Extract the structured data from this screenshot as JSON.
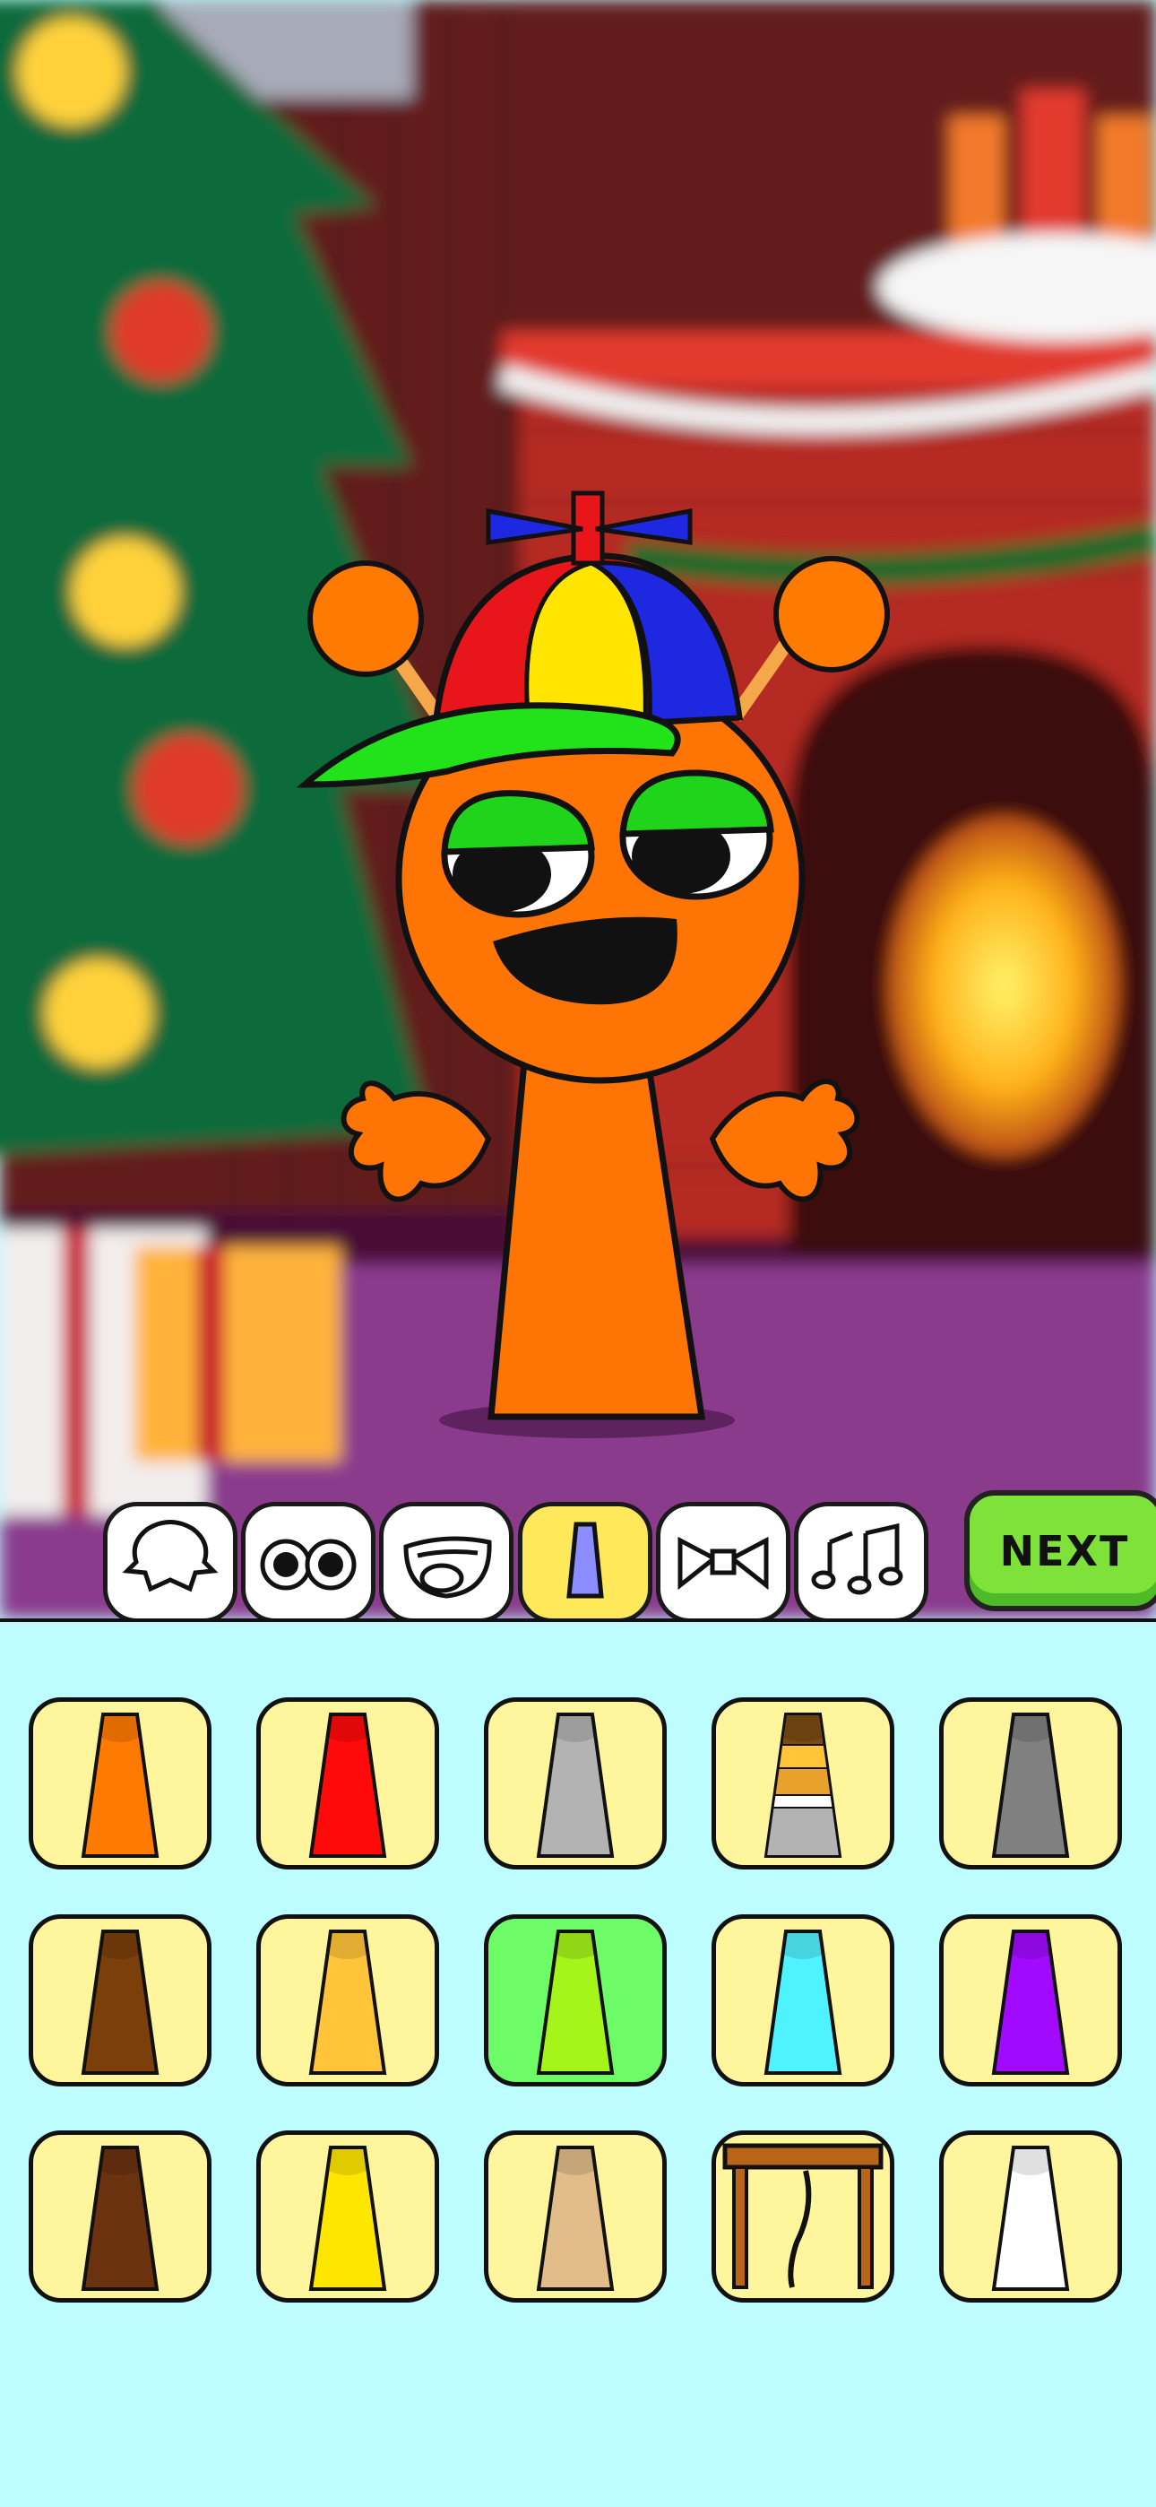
{
  "toolbar": {
    "tabs": [
      {
        "name": "head-shape",
        "icon": "head-shape-icon"
      },
      {
        "name": "eyes",
        "icon": "eyes-icon"
      },
      {
        "name": "mouth",
        "icon": "mouth-icon"
      },
      {
        "name": "body",
        "icon": "body-icon",
        "active": true
      },
      {
        "name": "accessory",
        "icon": "bow-tie-icon"
      },
      {
        "name": "sound",
        "icon": "music-notes-icon"
      }
    ],
    "next_label": "NEXT"
  },
  "body_options": [
    {
      "color": "#ff7a00"
    },
    {
      "color": "#ff0a0a"
    },
    {
      "color": "#b3b3b3"
    },
    {
      "color": "#e8b23a",
      "style": "striped"
    },
    {
      "color": "#808080"
    },
    {
      "color": "#7a3f0b"
    },
    {
      "color": "#ffc43a"
    },
    {
      "color": "#a6f51a",
      "selected": true
    },
    {
      "color": "#4ff2ff"
    },
    {
      "color": "#a20aff"
    },
    {
      "color": "#6b3210"
    },
    {
      "color": "#ffe600"
    },
    {
      "color": "#e2bd8a"
    },
    {
      "color": "#b8651a",
      "style": "table"
    },
    {
      "color": "#ffffff"
    }
  ]
}
